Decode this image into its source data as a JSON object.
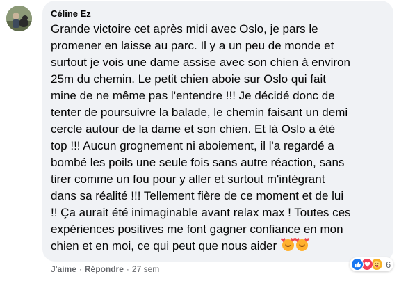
{
  "comment": {
    "author": "Céline Ez",
    "lines": [
      "Grande victoire cet après midi avec Oslo, je pars le",
      "promener en laisse au parc. Il y a un peu de monde et",
      "surtout je vois une dame assise avec son chien à environ",
      "25m du chemin. Le petit chien aboie sur Oslo qui fait",
      "mine de ne même pas l'entendre !!! Je décidé donc de",
      "tenter de poursuivre la balade, le chemin faisant un demi",
      "cercle autour de la dame et son chien. Et là Oslo a été",
      "top !!! Aucun grognement ni aboiement, il l'a regardé a",
      "bombé les poils une seule fois sans autre réaction, sans",
      "tirer comme un fou pour y aller et surtout m'intégrant",
      "dans sa réalité !!! Tellement fière de ce moment et de lui",
      "!! Ça aurait été inimaginable avant relax max ! Toutes ces",
      "expériences positives me font gagner confiance en mon",
      "chien et en moi, ce qui peut que nous aider"
    ],
    "trailing_emojis": [
      "smiling-face-with-hearts",
      "smiling-face-with-hearts"
    ]
  },
  "actions": {
    "like": "J'aime",
    "separator": "·",
    "reply": "Répondre",
    "time": "27 sem"
  },
  "reactions": {
    "icons": [
      "like",
      "love",
      "care"
    ],
    "count": "6"
  },
  "colors": {
    "bubble": "#f0f2f5",
    "text": "#050505",
    "meta": "#65676b",
    "like": "#1877f2",
    "love": "#f33e58",
    "care": "#f7b125"
  }
}
